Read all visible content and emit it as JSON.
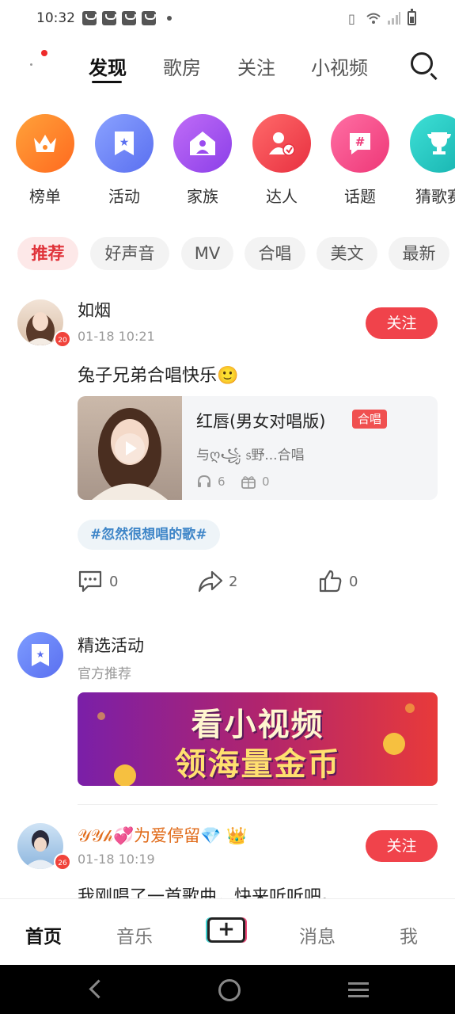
{
  "status_bar": {
    "time": "10:32"
  },
  "top_nav": {
    "tabs": [
      {
        "label": "发现",
        "active": true
      },
      {
        "label": "歌房",
        "active": false
      },
      {
        "label": "关注",
        "active": false
      },
      {
        "label": "小视频",
        "active": false
      }
    ]
  },
  "categories": [
    {
      "label": "榜单",
      "icon": "crown-icon",
      "color": "#ff8a2a"
    },
    {
      "label": "活动",
      "icon": "star-bookmark-icon",
      "color": "#6a7ff5"
    },
    {
      "label": "家族",
      "icon": "house-person-icon",
      "color": "#a356f0"
    },
    {
      "label": "达人",
      "icon": "person-check-icon",
      "color": "#f24a58"
    },
    {
      "label": "话题",
      "icon": "hashtag-icon",
      "color": "#f24a8a"
    },
    {
      "label": "猜歌赛",
      "icon": "trophy-icon",
      "color": "#2cc9c2"
    }
  ],
  "filters": [
    "推荐",
    "好声音",
    "MV",
    "合唱",
    "美文",
    "最新"
  ],
  "posts": [
    {
      "user": "如烟",
      "level": "20",
      "time": "01-18 10:21",
      "follow_label": "关注",
      "text": "兔子兄弟合唱快乐🙂",
      "song": {
        "title": "红唇(男女对唱版)",
        "badge": "合唱",
        "singers": "与ღ꧁ ᥉野...合唱",
        "plays": "6",
        "gifts": "0"
      },
      "tag": "#忽然很想唱的歌#",
      "comments": "0",
      "shares": "2",
      "likes": "0"
    },
    {
      "user": "𝒴𝒴𝒽💞为爱停留💎 👑",
      "level": "26",
      "time": "01-18 10:19",
      "follow_label": "关注",
      "text": "我刚唱了一首歌曲，快来听听吧。"
    }
  ],
  "activity": {
    "title": "精选活动",
    "subtitle": "官方推荐",
    "banner_line1": "看小视频",
    "banner_line2": "领海量金币"
  },
  "bottom_nav": [
    "首页",
    "音乐",
    "+",
    "消息",
    "我"
  ]
}
